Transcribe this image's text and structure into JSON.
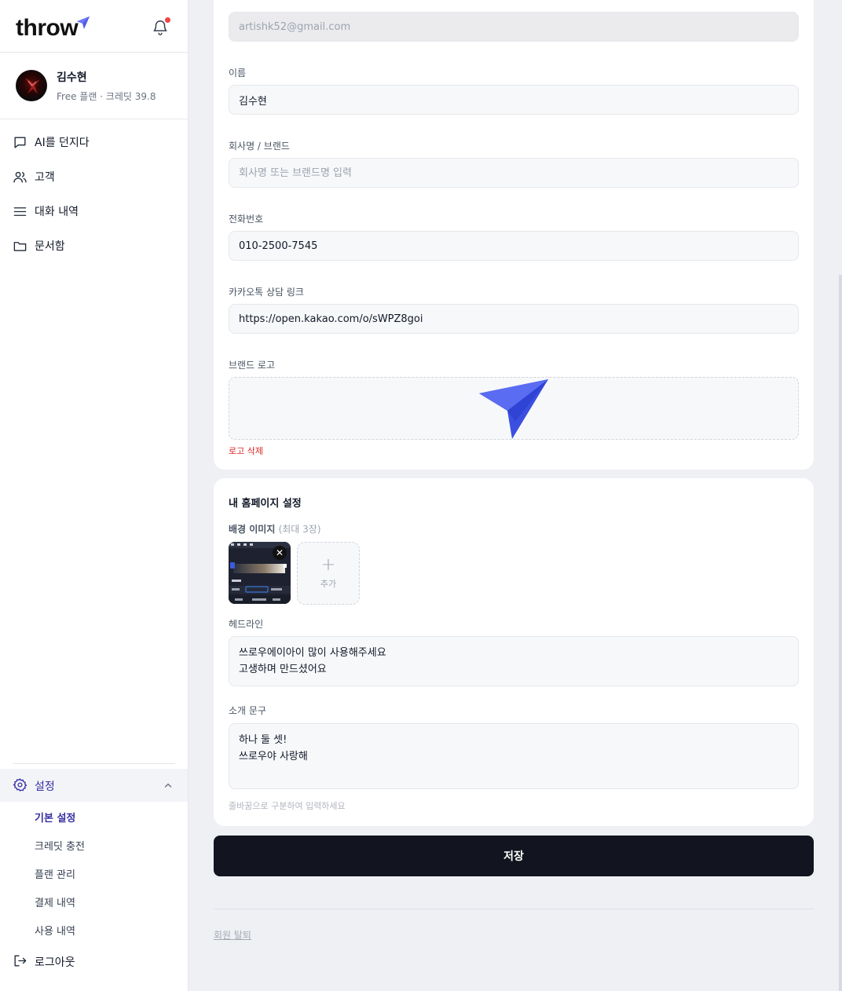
{
  "app": {
    "logo_text": "throw",
    "notification_icon": "bell-icon",
    "accent": "#4f5bea",
    "notification_dot": "#ef4444"
  },
  "profile": {
    "name": "김수현",
    "plan": "Free 플랜 · 크레딧 39.8"
  },
  "nav": {
    "items": [
      {
        "label": "AI를 던지다",
        "icon": "chat-icon"
      },
      {
        "label": "고객",
        "icon": "users-icon"
      },
      {
        "label": "대화 내역",
        "icon": "list-icon"
      },
      {
        "label": "문서함",
        "icon": "folder-icon"
      }
    ],
    "settings": {
      "label": "설정",
      "icon": "gear-icon"
    },
    "sub_items": [
      "기본 설정",
      "크레딧 충전",
      "플랜 관리",
      "결제 내역",
      "사용 내역"
    ],
    "logout": "로그아웃"
  },
  "form": {
    "email_value": "artishk52@gmail.com",
    "name_label": "이름",
    "name_value": "김수현",
    "company_label": "회사명 / 브랜드",
    "company_placeholder": "회사명 또는 브랜드명 입력",
    "phone_label": "전화번호",
    "phone_value": "010-2500-7545",
    "kakao_label": "카카오톡 상담 링크",
    "kakao_value": "https://open.kakao.com/o/sWPZ8goi",
    "logo_label": "브랜드 로고",
    "logo_delete": "로고 삭제"
  },
  "homepage": {
    "title": "내 홈페이지 설정",
    "bg_label": "배경 이미지",
    "bg_limit": "(최대 3장)",
    "add_label": "추가",
    "headline_label": "헤드라인",
    "headline_value": "쓰로우에이아이 많이 사용해주세요\n고생하며 만드셨어요",
    "intro_label": "소개 문구",
    "intro_value": "하나 둘 셋!\n쓰로우야 사랑해",
    "hint": "줄바꿈으로 구분하여 입력하세요"
  },
  "actions": {
    "save": "저장",
    "withdraw": "회원 탈퇴"
  }
}
